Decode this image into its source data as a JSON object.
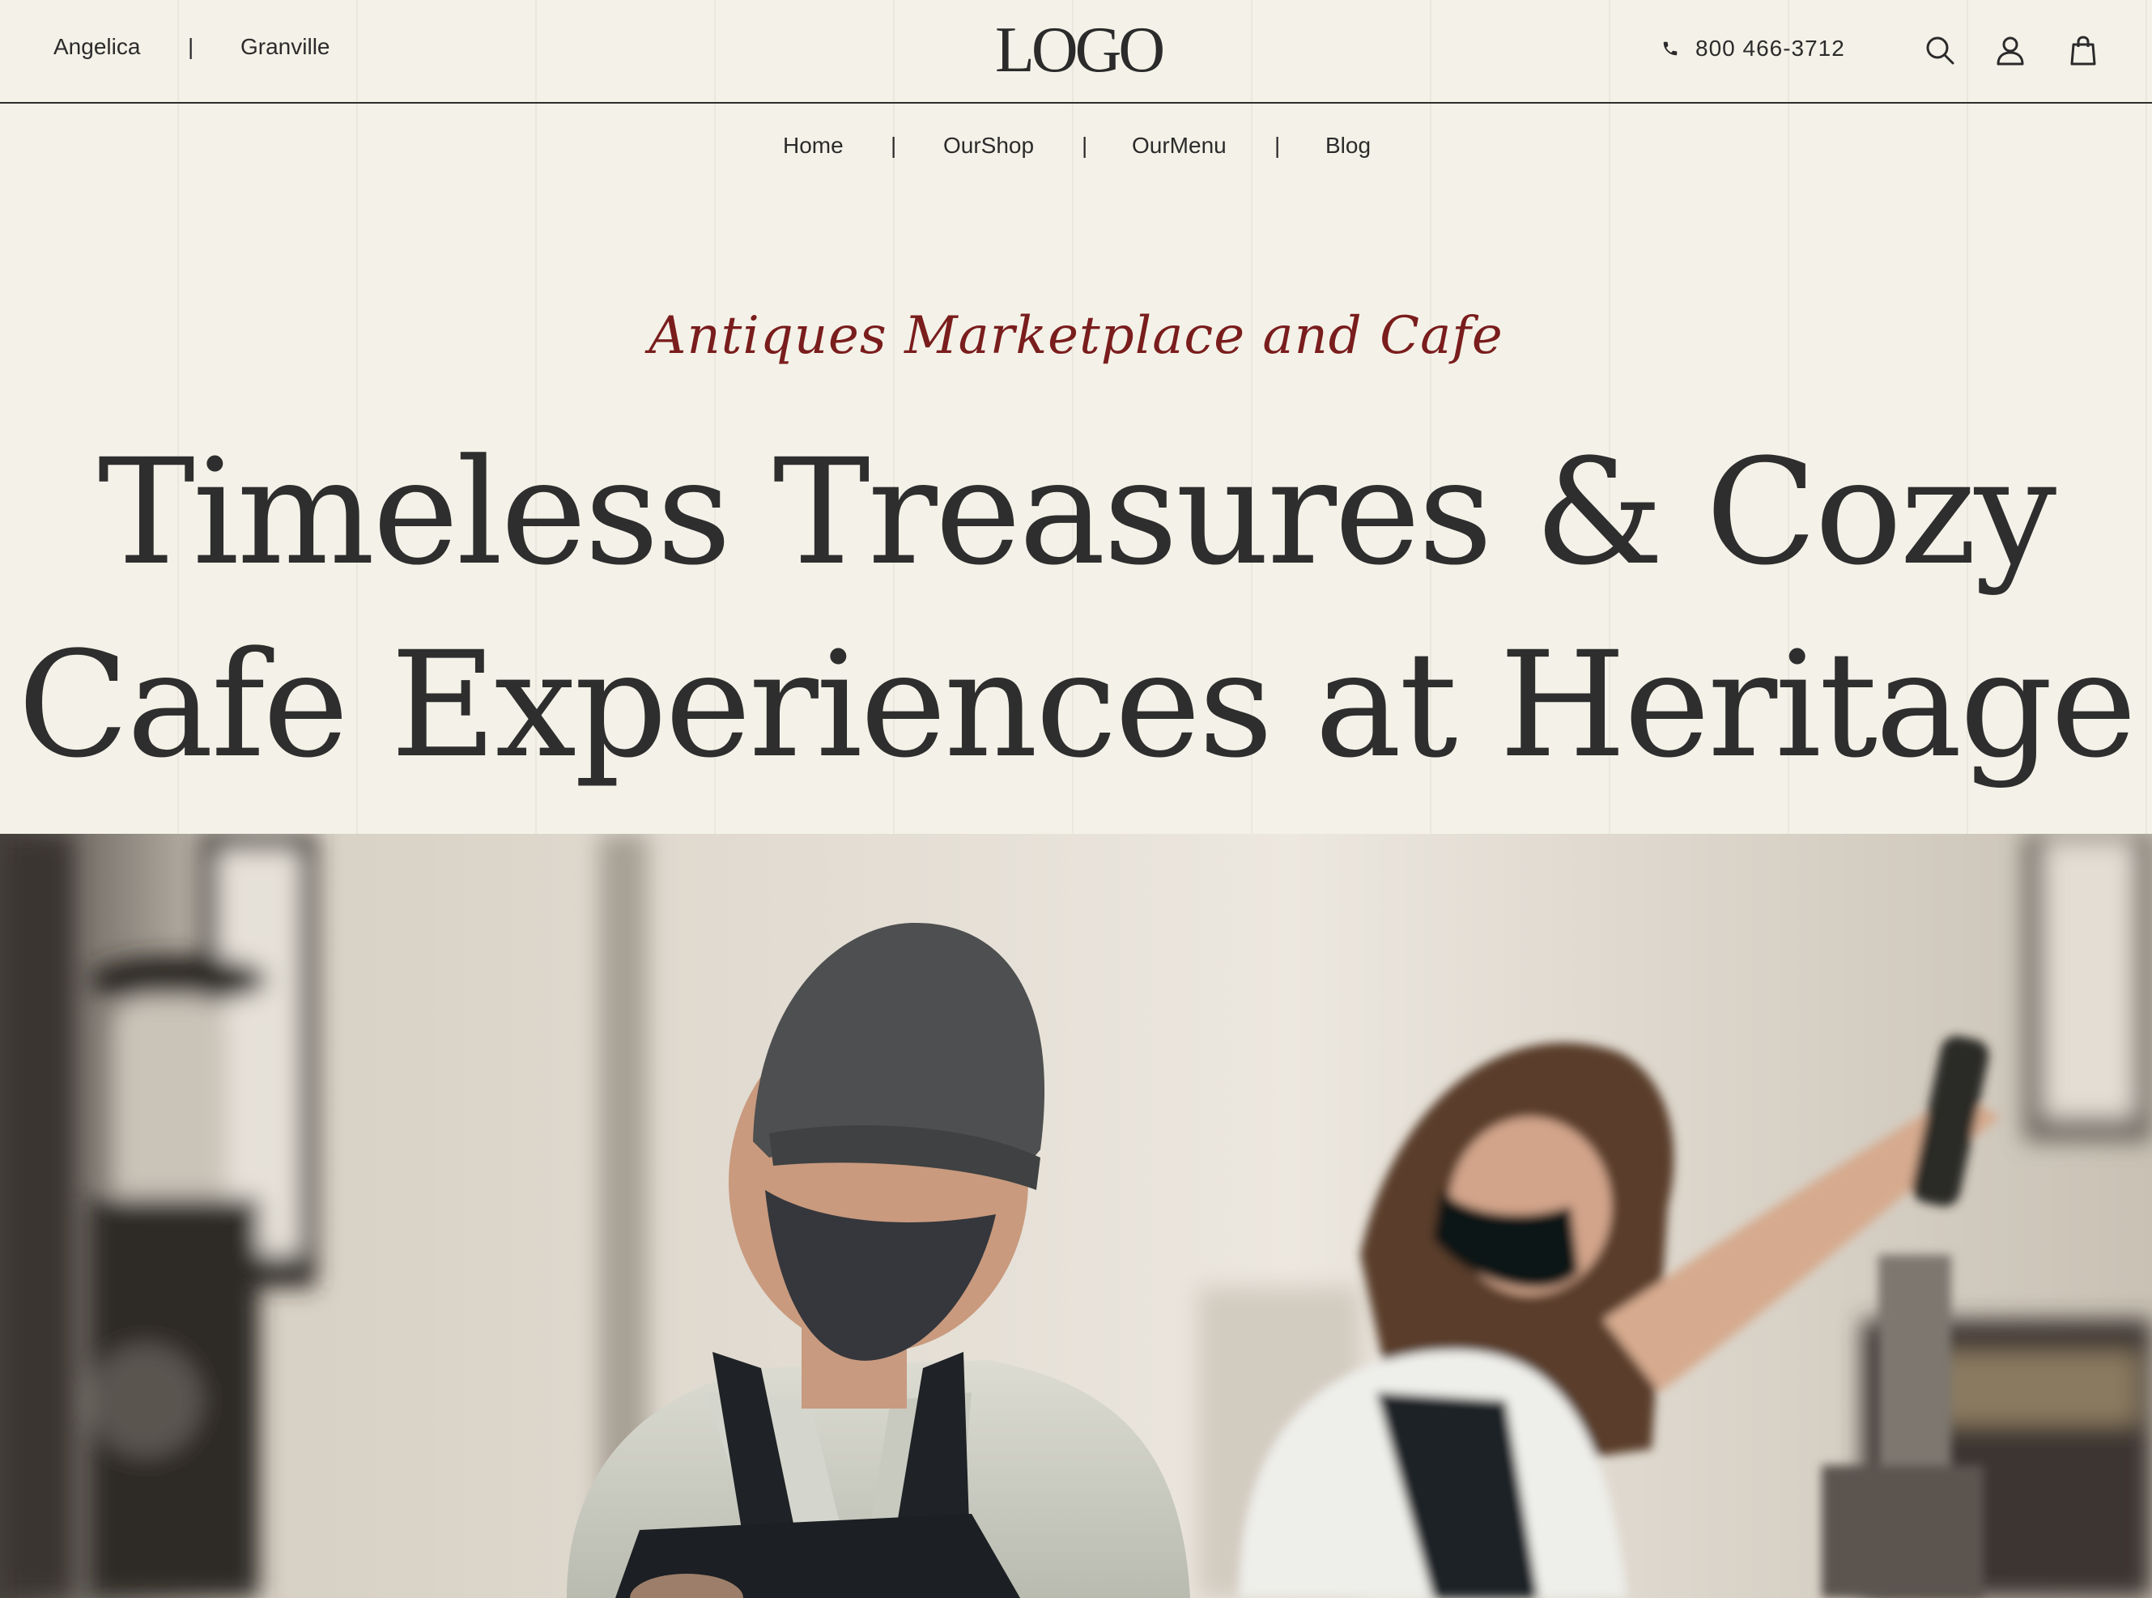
{
  "header": {
    "locations": [
      "Angelica",
      "Granville"
    ],
    "location_separator": "|",
    "logo": "LOGO",
    "phone": "800 466-3712",
    "icons": [
      "phone-icon",
      "search-icon",
      "user-icon",
      "shopping-bag-icon"
    ]
  },
  "nav": {
    "items": [
      "Home",
      "OurShop",
      "OurMenu",
      "Blog"
    ],
    "separator": "|"
  },
  "hero": {
    "tagline": "Antiques Marketplace and Cafe",
    "headline_line1": "Timeless Treasures & Cozy",
    "headline_line2": "Cafe Experiences at Heritage",
    "image": "baristas-in-masks-photo"
  },
  "colors": {
    "background": "#f4f2e8",
    "text": "#2e2e2e",
    "accent": "#7a1d1d"
  }
}
